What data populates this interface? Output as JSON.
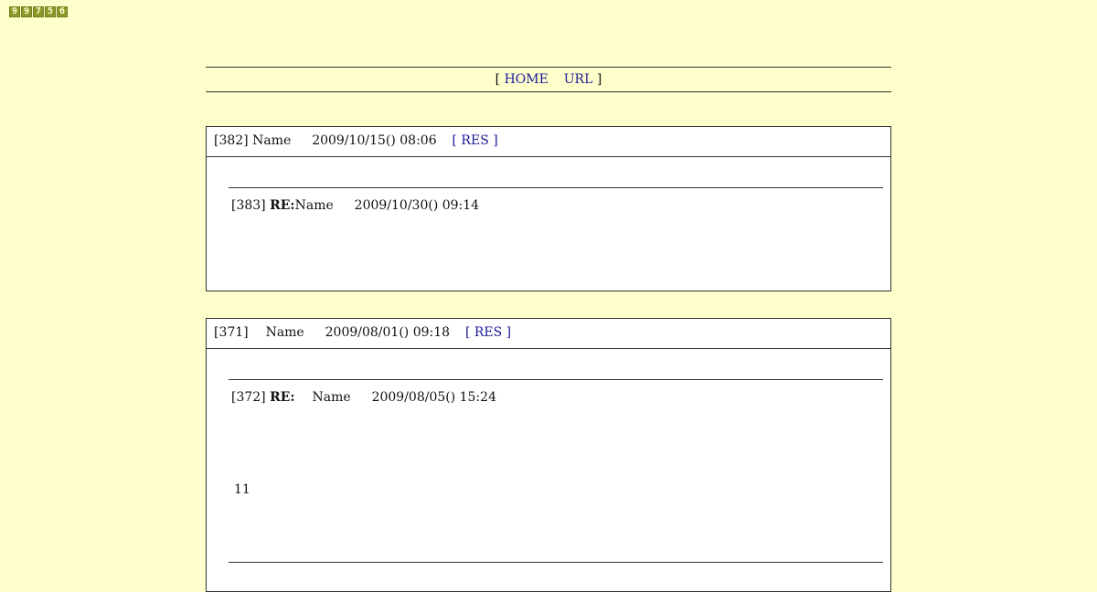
{
  "counter": {
    "digits": [
      "9",
      "9",
      "7",
      "5",
      "6"
    ]
  },
  "nav": {
    "open": "[",
    "home": "HOME",
    "url": "URL",
    "close": "]"
  },
  "threads": [
    {
      "id": "[382]",
      "name": "Name",
      "date": "2009/10/15() 08:06",
      "res_label": "[ RES ]",
      "replies": [
        {
          "id": "[383]",
          "re": "RE:",
          "name": "Name",
          "date": "2009/10/30() 09:14",
          "body": ""
        }
      ]
    },
    {
      "id": "[371]",
      "name": "Name",
      "date": "2009/08/01() 09:18",
      "res_label": "[ RES ]",
      "replies": [
        {
          "id": "[372]",
          "re": "RE:",
          "name": "Name",
          "date": "2009/08/05() 15:24",
          "body": "11"
        }
      ]
    }
  ]
}
